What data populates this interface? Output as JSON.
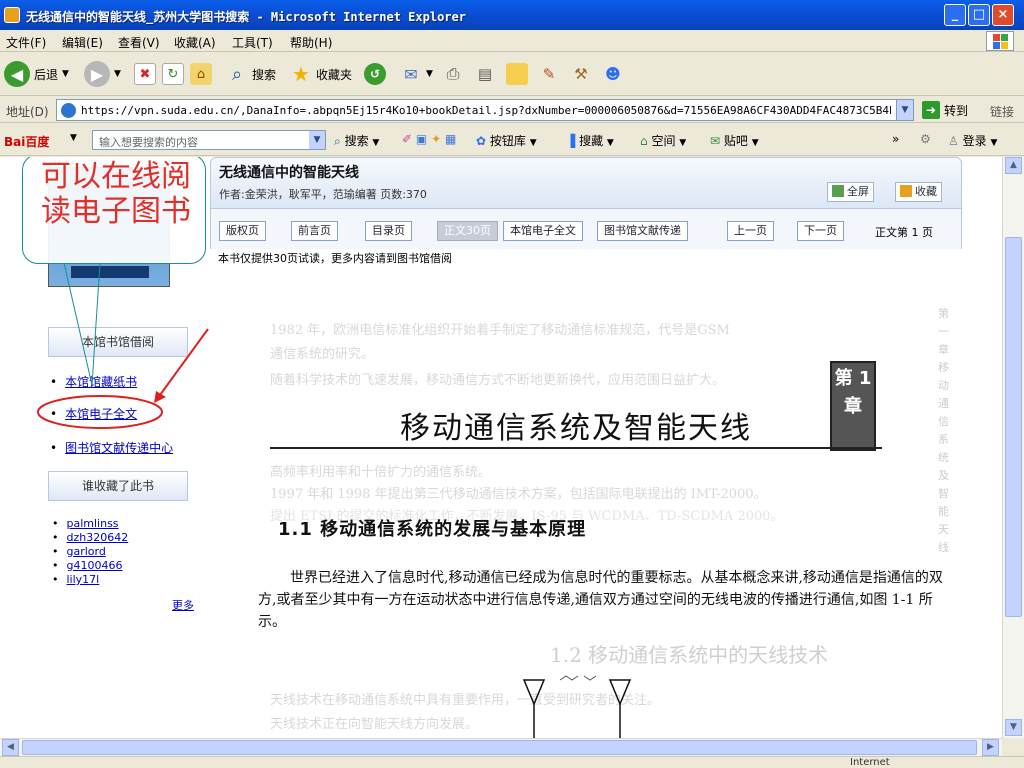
{
  "window": {
    "title": "无线通信中的智能天线_苏州大学图书搜索 - Microsoft Internet Explorer",
    "controls": [
      "_",
      "□",
      "×"
    ]
  },
  "menu": {
    "items": [
      "文件(F)",
      "编辑(E)",
      "查看(V)",
      "收藏(A)",
      "工具(T)",
      "帮助(H)"
    ]
  },
  "toolbar": {
    "back": "后退",
    "search": "搜索",
    "favorites": "收藏夹"
  },
  "address": {
    "label": "地址(D)",
    "url": "https://vpn.suda.edu.cn/,DanaInfo=.abpqn5Ej15r4Ko10+bookDetail.jsp?dxNumber=000006050876&d=71556EA98A6CF430ADD4FAC4873C5B4E&fenl",
    "go": "转到",
    "links": "链接"
  },
  "baidu": {
    "logo": "Bai百度",
    "search_placeholder": "输入想要搜索的内容",
    "search_btn": "搜索",
    "button_lib": "按钮库",
    "favorites": "搜藏",
    "space": "空间",
    "tieba": "贴吧",
    "login": "登录"
  },
  "sidebar": {
    "section1_heading": "本馆书馆借阅",
    "links": [
      "本馆馆藏纸书",
      "本馆电子全文",
      "图书馆文献传递中心"
    ],
    "section2_heading": "谁收藏了此书",
    "users": [
      "palmlinss",
      "dzh320642",
      "garlord",
      "g4100466",
      "lily17l"
    ],
    "more": "更多"
  },
  "callout": {
    "text": "可以在线阅读电子图书"
  },
  "book": {
    "title": "无线通信中的智能天线",
    "meta": "作者:金荣洪，耿军平，范瑜编著  页数:370",
    "fullscreen": "全屏",
    "collect": "收藏",
    "nav": [
      "版权页",
      "前言页",
      "目录页",
      "正文30页",
      "本馆电子全文",
      "图书馆文献传递"
    ],
    "prev": "上一页",
    "next": "下一页",
    "page_indicator": "正文第 1 页",
    "trial_note": "本书仅提供30页试读，更多内容请到图书馆借阅"
  },
  "scan": {
    "chapter_title": "移动通信系统及智能天线",
    "chapter_box": "第 1 章",
    "section_title": "1.1   移动通信系统的发展与基本原理",
    "body": "世界已经进入了信息时代,移动通信已经成为信息时代的重要标志。从基本概念来讲,移动通信是指通信的双方,或者至少其中有一方在运动状态中进行信息传递,通信双方通过空间的无线电波的传播进行通信,如图 1-1 所示。",
    "ghost_lines": [
      "1982 年，欧洲电信标准化组织开始着手制定了移动通信标准规范，代号是GSM",
      "通信系统的研究。",
      "随着科学技术的飞速发展，移动通信方式不断地更新换代，应用范围日益扩大。",
      "高频率利用率和十倍扩力的通信系统。",
      "1997 年和 1998 年提出第三代移动通信技术方案，包括国际电联提出的 IMT-2000。",
      "提出 ETSI 的提交的标准化工作，不断发展，IS-95 与 WCDMA、TD-SCDMA 2000。",
      "1.2   移动通信系统中的天线技术",
      "天线技术在移动通信系统中具有重要作用，一直受到研究者的关注。",
      "天线技术正在向智能天线方向发展。"
    ],
    "side_text": "第一章 移动通信系统及智能天线"
  },
  "status": {
    "zone": "Internet"
  },
  "colors": {
    "titlebar": "#0b4fd8",
    "callout_text": "#e0302a",
    "callout_border": "#1b8e8e",
    "link": "#0000cc",
    "annotation_arrow": "#e02020"
  }
}
